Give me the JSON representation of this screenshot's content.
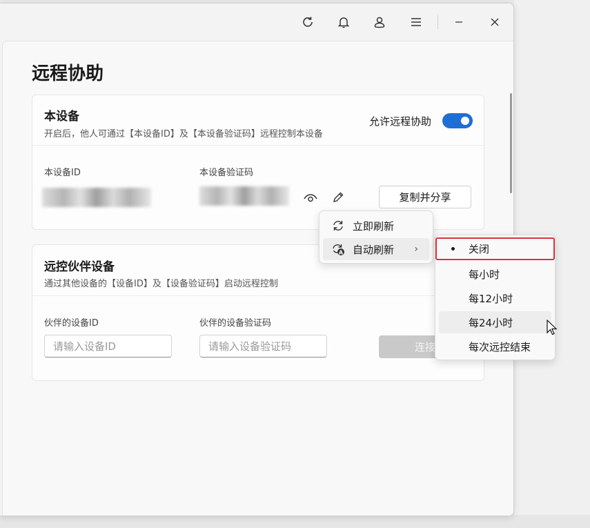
{
  "window": {
    "title": "远程协助"
  },
  "titlebar": {
    "icons": [
      "refresh-icon",
      "bell-icon",
      "user-icon",
      "menu-icon",
      "minimize-icon",
      "close-icon"
    ]
  },
  "this_device": {
    "title": "本设备",
    "desc": "开启后，他人可通过【本设备ID】及【本设备验证码】远程控制本设备",
    "allow_label": "允许远程协助",
    "allow_enabled": true,
    "id_label": "本设备ID",
    "code_label": "本设备验证码",
    "copy_share": "复制并分享"
  },
  "partner": {
    "title": "远控伙伴设备",
    "desc": "通过其他设备的【设备ID】及【设备验证码】启动远程控制",
    "id_label": "伙伴的设备ID",
    "code_label": "伙伴的设备验证码",
    "id_placeholder": "请输入设备ID",
    "code_placeholder": "请输入设备验证码",
    "connect": "连接"
  },
  "context_menu": {
    "items": [
      {
        "label": "立即刷新",
        "icon": "refresh-icon"
      },
      {
        "label": "自动刷新",
        "icon": "auto-refresh-icon",
        "has_submenu": true
      }
    ]
  },
  "submenu": {
    "items": [
      {
        "label": "关闭",
        "selected": true
      },
      {
        "label": "每小时"
      },
      {
        "label": "每12小时"
      },
      {
        "label": "每24小时",
        "hover": true
      },
      {
        "label": "每次远控结束"
      }
    ]
  },
  "colors": {
    "accent": "#1f6ed4",
    "highlight_border": "#d9333d"
  }
}
